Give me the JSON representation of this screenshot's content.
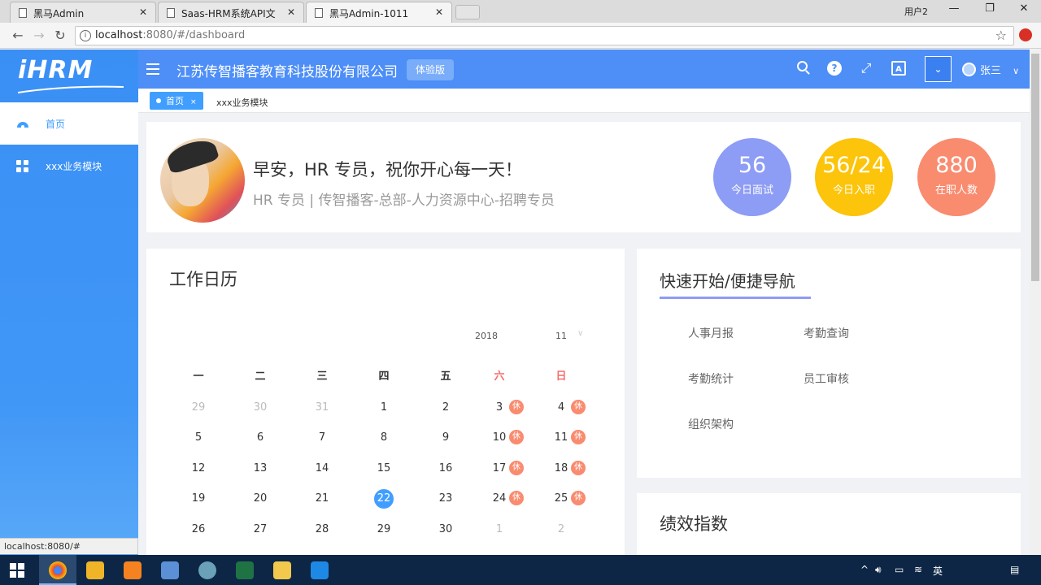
{
  "browser": {
    "tabs": [
      {
        "title": "黑马Admin"
      },
      {
        "title": "Saas-HRM系统API文"
      },
      {
        "title": "黑马Admin-1011"
      }
    ],
    "window_user": "用户2",
    "url_host": "localhost",
    "url_rest": ":8080/#/dashboard",
    "status_url": "localhost:8080/#"
  },
  "app": {
    "logo_text": "iHRM",
    "company_name": "江苏传智播客教育科技股份有限公司",
    "trial_badge": "体验版",
    "user_name": "张三",
    "sidebar": [
      {
        "label": "首页",
        "icon": "dashboard-icon",
        "active": true
      },
      {
        "label": "xxx业务模块",
        "icon": "grid-icon",
        "active": false
      }
    ],
    "tags": {
      "home": "首页",
      "home_close": "×",
      "module": "xxx业务模块"
    },
    "welcome": {
      "greeting": "早安，HR 专员，祝你开心每一天！",
      "subtitle": "HR 专员 | 传智播客-总部-人力资源中心-招聘专员"
    },
    "stats": [
      {
        "value": "56",
        "label": "今日面试",
        "color": "#8d9cf4"
      },
      {
        "value": "56/24",
        "label": "今日入职",
        "color": "#fcc40a"
      },
      {
        "value": "880",
        "label": "在职人数",
        "color": "#f98b6f"
      }
    ],
    "calendar": {
      "title": "工作日历",
      "year": "2018",
      "month": "11",
      "weekdays": [
        "一",
        "二",
        "三",
        "四",
        "五",
        "六",
        "日"
      ],
      "rest_label": "休",
      "weeks": [
        [
          "29",
          "30",
          "31",
          "1",
          "2",
          "3",
          "4"
        ],
        [
          "5",
          "6",
          "7",
          "8",
          "9",
          "10",
          "11"
        ],
        [
          "12",
          "13",
          "14",
          "15",
          "16",
          "17",
          "18"
        ],
        [
          "19",
          "20",
          "21",
          "22",
          "23",
          "24",
          "25"
        ],
        [
          "26",
          "27",
          "28",
          "29",
          "30",
          "1",
          "2"
        ]
      ],
      "today": "22"
    },
    "quick_nav": {
      "title": "快速开始/便捷导航",
      "links": [
        "人事月报",
        "考勤查询",
        "考勤统计",
        "员工审核",
        "组织架构"
      ]
    },
    "performance": {
      "title": "绩效指数"
    }
  },
  "taskbar": {
    "ime": "英"
  }
}
